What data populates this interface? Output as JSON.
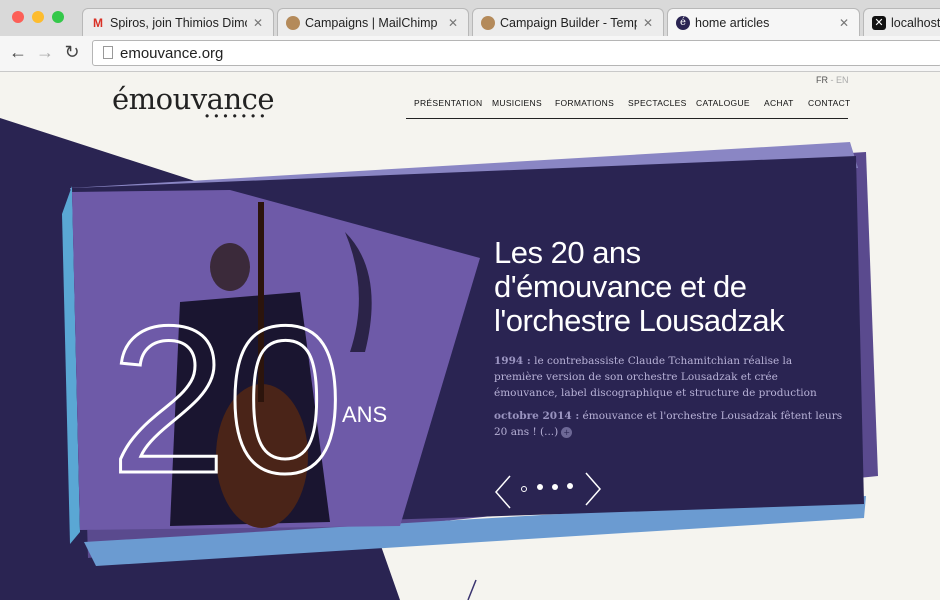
{
  "browser": {
    "tabs": [
      {
        "title": "Spiros, join Thimios Dimop",
        "favicon": "gmail-icon",
        "active": false
      },
      {
        "title": "Campaigns | MailChimp",
        "favicon": "mailchimp-icon",
        "active": false
      },
      {
        "title": "Campaign Builder - Templa",
        "favicon": "mailchimp-icon",
        "active": false
      },
      {
        "title": "home articles",
        "favicon": "emouvance-icon",
        "active": true
      },
      {
        "title": "localhost:",
        "favicon": "x-icon",
        "active": false
      }
    ],
    "url": "emouvance.org"
  },
  "site": {
    "logo": "émouvance",
    "lang": {
      "fr": "FR",
      "sep": "-",
      "en": "EN"
    },
    "nav": [
      "PRÉSENTATION",
      "MUSICIENS",
      "FORMATIONS",
      "SPECTACLES",
      "CATALOGUE",
      "ACHAT",
      "CONTACT"
    ],
    "hero": {
      "title_lines": [
        "Les 20 ans",
        "d'émouvance et de",
        "l'orchestre Lousadzak"
      ],
      "p1_year": "1994 :",
      "p1_text": " le contrebassiste Claude Tchamitchian réalise la première version de son orchestre Lousadzak et crée émouvance, label discographique et structure de production",
      "p2_year": "octobre 2014 :",
      "p2_text": " émouvance et l'orchestre Lousadzak fêtent leurs 20 ans ! (...)",
      "badge_number": "20",
      "badge_word": "ANS",
      "slides": 4,
      "current_slide": 0
    }
  },
  "colors": {
    "navy": "#2a2452",
    "purple_mid": "#4a3a80",
    "photo_purple": "#6e5aa8",
    "accent_blue": "#5aa7d4"
  }
}
